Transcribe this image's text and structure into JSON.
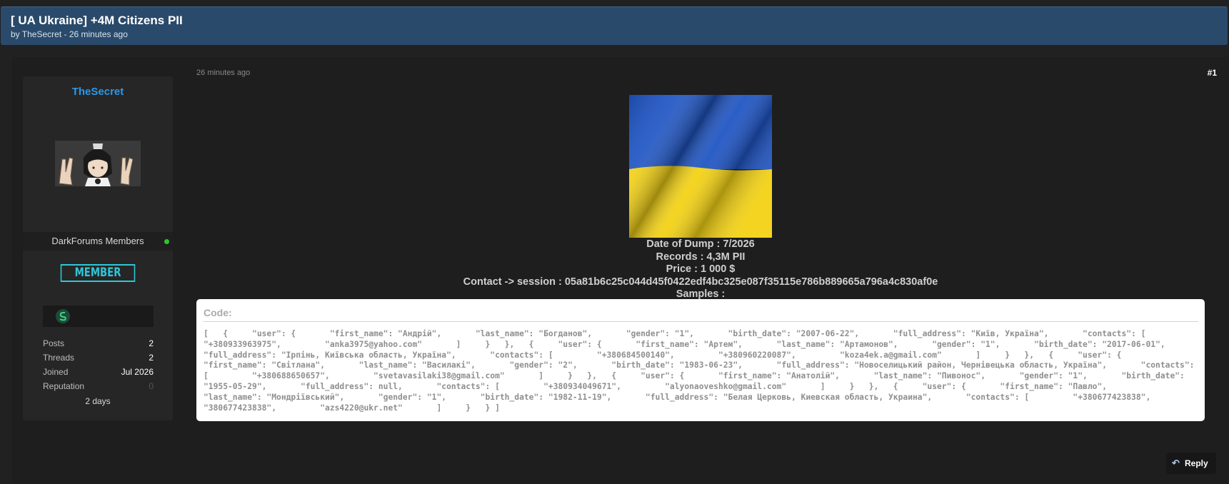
{
  "thread": {
    "title": "[ UA Ukraine] +4M Citizens PII",
    "byline": "by TheSecret - 26 minutes ago"
  },
  "author": {
    "username": "TheSecret",
    "group": "DarkForums Members",
    "badge": "MEMBER",
    "online": true,
    "stats": [
      {
        "label": "Posts",
        "value": "2"
      },
      {
        "label": "Threads",
        "value": "2"
      },
      {
        "label": "Joined",
        "value": "Jul 2026"
      },
      {
        "label": "Reputation",
        "value": "0"
      }
    ],
    "last_seen": "2 days"
  },
  "post": {
    "time": "26 minutes ago",
    "number": "#1",
    "flag_colors": {
      "top": "#1f55c4",
      "bottom": "#f3d215"
    },
    "lines": [
      "Date of Dump : 7/2026",
      "Records : 4,3M PII",
      "Price : 1 000 $",
      "Contact -> session : 05a81b6c25c044d45f0422edf4bc325e087f35115e786b889665a796a4c830af0e",
      "Samples :"
    ],
    "code": {
      "title": "Code:",
      "text": "[   {     \"user\": {       \"first_name\": \"Андрій\",       \"last_name\": \"Богданов\",       \"gender\": \"1\",       \"birth_date\": \"2007-06-22\",       \"full_address\": \"Київ, Україна\",       \"contacts\": [         \"+380933963975\",         \"anka3975@yahoo.com\"       ]     }   },   {     \"user\": {       \"first_name\": \"Артем\",       \"last_name\": \"Артамонов\",       \"gender\": \"1\",       \"birth_date\": \"2017-06-01\",       \"full_address\": \"Ірпінь, Київська область, Україна\",       \"contacts\": [         \"+380684500140\",         \"+380960220087\",         \"koza4ek.a@gmail.com\"       ]     }   },   {     \"user\": {       \"first_name\": \"Світлана\",       \"last_name\": \"Василакі\",       \"gender\": \"2\",       \"birth_date\": \"1983-06-23\",       \"full_address\": \"Новоселицький район, Чернівецька область, Україна\",       \"contacts\": [         \"+380688650657\",         \"svetavasilaki38@gmail.com\"       ]     }   },   {     \"user\": {       \"first_name\": \"Анатолій\",       \"last_name\": \"Пивонос\",       \"gender\": \"1\",       \"birth_date\": \"1955-05-29\",       \"full_address\": null,       \"contacts\": [         \"+380934049671\",         \"alyonaoveshko@gmail.com\"       ]     }   },   {     \"user\": {       \"first_name\": \"Павло\",       \"last_name\": \"Мондріївський\",       \"gender\": \"1\",       \"birth_date\": \"1982-11-19\",       \"full_address\": \"Белая Церковь, Киевская область, Украина\",       \"contacts\": [         \"+380677423838\",         \"380677423838\",         \"azs4220@ukr.net\"       ]     }   } ]"
    }
  },
  "actions": {
    "reply_label": "Reply"
  }
}
